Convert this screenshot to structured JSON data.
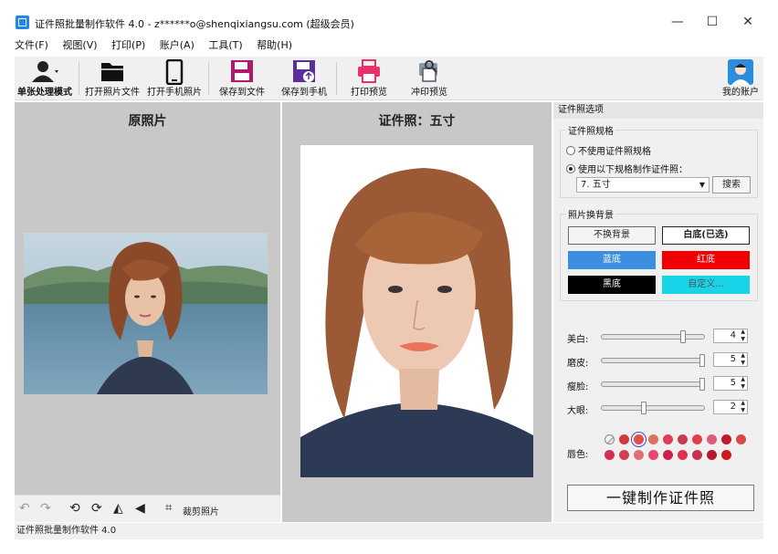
{
  "window": {
    "title": "证件照批量制作软件 4.0 - z******o@shenqixiangsu.com (超级会员)",
    "minimize": "—",
    "maximize": "☐",
    "close": "✕"
  },
  "menu": [
    "文件(F)",
    "视图(V)",
    "打印(P)",
    "账户(A)",
    "工具(T)",
    "帮助(H)"
  ],
  "toolbar": {
    "single_mode": "单张处理模式",
    "open_file": "打开照片文件",
    "open_phone": "打开手机照片",
    "save_file": "保存到文件",
    "save_phone": "保存到手机",
    "print_preview": "打印预览",
    "develop_preview": "冲印预览",
    "my_account": "我的账户"
  },
  "left": {
    "heading": "原照片",
    "crop_label": "裁剪照片"
  },
  "right": {
    "heading": "证件照：五寸"
  },
  "panel": {
    "title": "证件照选项",
    "spec_group": "证件照规格",
    "no_spec": "不使用证件照规格",
    "use_spec": "使用以下规格制作证件照：",
    "selected_size": "7. 五寸",
    "search": "搜索",
    "bg_group": "照片换背景",
    "bg_none": "不换背景",
    "bg_white": "白底(已选)",
    "bg_blue": "蓝底",
    "bg_red": "红底",
    "bg_black": "黑底",
    "bg_custom": "自定义...",
    "colors": {
      "blue": "#3b8fde",
      "red": "#f00000",
      "black": "#000000",
      "cyan": "#19d3e8"
    },
    "sliders": [
      {
        "label": "美白:",
        "value": "4",
        "level": 0.8
      },
      {
        "label": "磨皮:",
        "value": "5",
        "level": 1.0
      },
      {
        "label": "瘦脸:",
        "value": "5",
        "level": 1.0
      },
      {
        "label": "大眼:",
        "value": "2",
        "level": 0.4
      }
    ],
    "lip_label": "唇色:",
    "lip_colors_row1": [
      "#d23a3a",
      "#e0504a",
      "#e07060",
      "#e23a5a",
      "#c83a52",
      "#e0404a",
      "#e05a7a",
      "#c01a2a",
      "#d84848"
    ],
    "lip_colors_row2": [
      "#d23050",
      "#d04050",
      "#e07070",
      "#e84870",
      "#cc2050",
      "#e03050",
      "#c83050",
      "#b41a2a",
      "#cc1a1a"
    ],
    "make_button": "一键制作证件照"
  },
  "status": "证件照批量制作软件 4.0"
}
